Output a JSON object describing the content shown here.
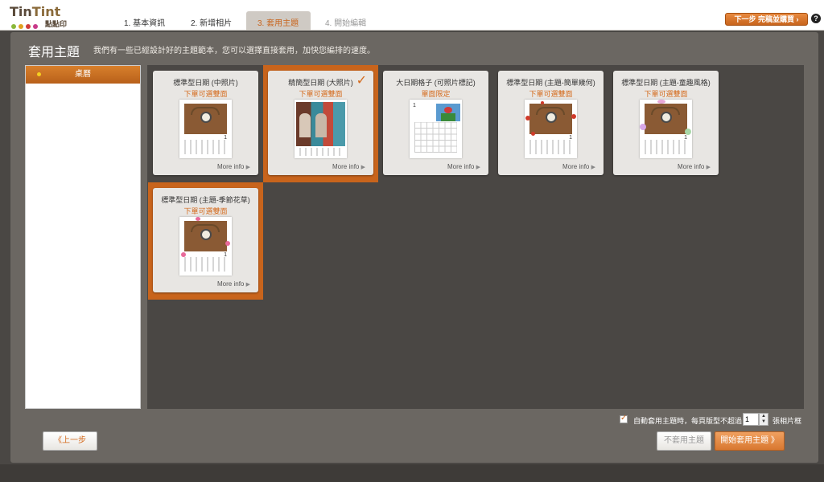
{
  "logo": {
    "text_a": "Tin",
    "text_b": "Tint",
    "sub": "點點印",
    "dot_colors": [
      "#8ab83a",
      "#e0a020",
      "#d03a3a",
      "#c83a8a"
    ]
  },
  "steps": [
    {
      "label": "1. 基本資訊"
    },
    {
      "label": "2. 新增相片"
    },
    {
      "label": "3. 套用主題"
    },
    {
      "label": "4. 開始編輯"
    }
  ],
  "header": {
    "next_label": "下一步 完稿並購買 ›",
    "help": "?"
  },
  "page": {
    "title": "套用主題",
    "subtitle": "我們有一些已經設計好的主題範本，您可以選擇直接套用，加快您編排的速度。"
  },
  "sidebar": {
    "items": [
      {
        "label": "桌曆"
      }
    ]
  },
  "templates": [
    {
      "title": "標準型日期 (中照片)",
      "sub": "下單可選雙面",
      "more": "More info",
      "cal_num": "1"
    },
    {
      "title": "精簡型日期 (大照片)",
      "sub": "下單可選雙面",
      "more": "More info",
      "check": "✓"
    },
    {
      "title": "大日期格子 (可照片標記)",
      "sub": "單面限定",
      "more": "More info",
      "cal_num": "1"
    },
    {
      "title": "標準型日期 (主題-簡單幾何)",
      "sub": "下單可選雙面",
      "more": "More info",
      "cal_num": "1"
    },
    {
      "title": "標準型日期 (主題-童趣風格)",
      "sub": "下單可選雙面",
      "more": "More info",
      "cal_num": "1"
    },
    {
      "title": "標準型日期 (主題-季節花草)",
      "sub": "下單可選雙面",
      "more": "More info",
      "cal_num": "1"
    }
  ],
  "footer": {
    "auto_label": "自動套用主題時，每頁版型不超過",
    "auto_value": "1",
    "auto_unit": "張相片框",
    "prev_label": "《上一步",
    "noapply_label": "不套用主題",
    "apply_label": "開始套用主題 》"
  },
  "colors": {
    "accent": "#c8641c",
    "panel": "#6b6762",
    "content_bg": "#4a4744"
  }
}
